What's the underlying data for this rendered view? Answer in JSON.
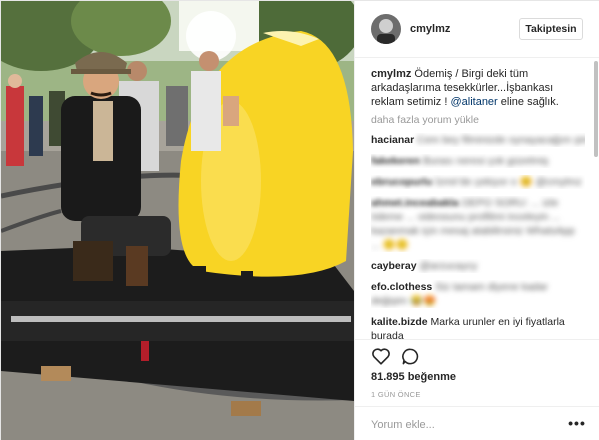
{
  "header": {
    "username": "cmylmz",
    "follow_label": "Takiptesin"
  },
  "post": {
    "caption_user": "cmylmz",
    "caption_text_1": " Ödemiş / Birgi deki tüm arkadaşlarıma tesekkürler...İşbankası reklam setimiz ! ",
    "caption_mention": "@alitaner",
    "caption_text_2": " eline sağlık.",
    "load_more": "daha fazla yorum yükle"
  },
  "comments": [
    {
      "user": "hacianar",
      "text": "Cem bey filminizde oynayacağım şimdiden teşekkür ederim",
      "blurred": true
    },
    {
      "user": "fakekeren",
      "text": "Burası neresi çok güzelmiş",
      "blurred": true,
      "blur_user": true
    },
    {
      "user": "ebrucopurlu",
      "text": "İzmir'de çekiyor o 😊 @cmylmz",
      "blurred": true,
      "blur_user": true
    },
    {
      "user": "ahmet.inceabakla",
      "text": "OEPO SORU: ... izle ödeme ... videosunu profilimi inceleyin ... kazanmak için mesaj atabilirsiniz WhatsApp ... 🙂🙂",
      "blurred": true,
      "blur_user": true
    },
    {
      "user": "cayberay",
      "text": "@arzucaycy",
      "blurred": true
    },
    {
      "user": "efo.clothess",
      "text": "Siz tamam diyene kadar değişim 😂😍",
      "blurred": true
    },
    {
      "user": "kalite.bizde",
      "text": "Marka urunler en iyi fiyatlarla burada",
      "blurred": false
    }
  ],
  "actions": {
    "icons": [
      "heart-icon",
      "comment-icon"
    ],
    "likes": "81.895 beğenme",
    "time": "1 GÜN ÖNCE",
    "comment_placeholder": "Yorum ekle...",
    "more_label": "•••"
  },
  "colors": {
    "mention": "#003569",
    "muted": "#999999",
    "border": "#efefef"
  }
}
